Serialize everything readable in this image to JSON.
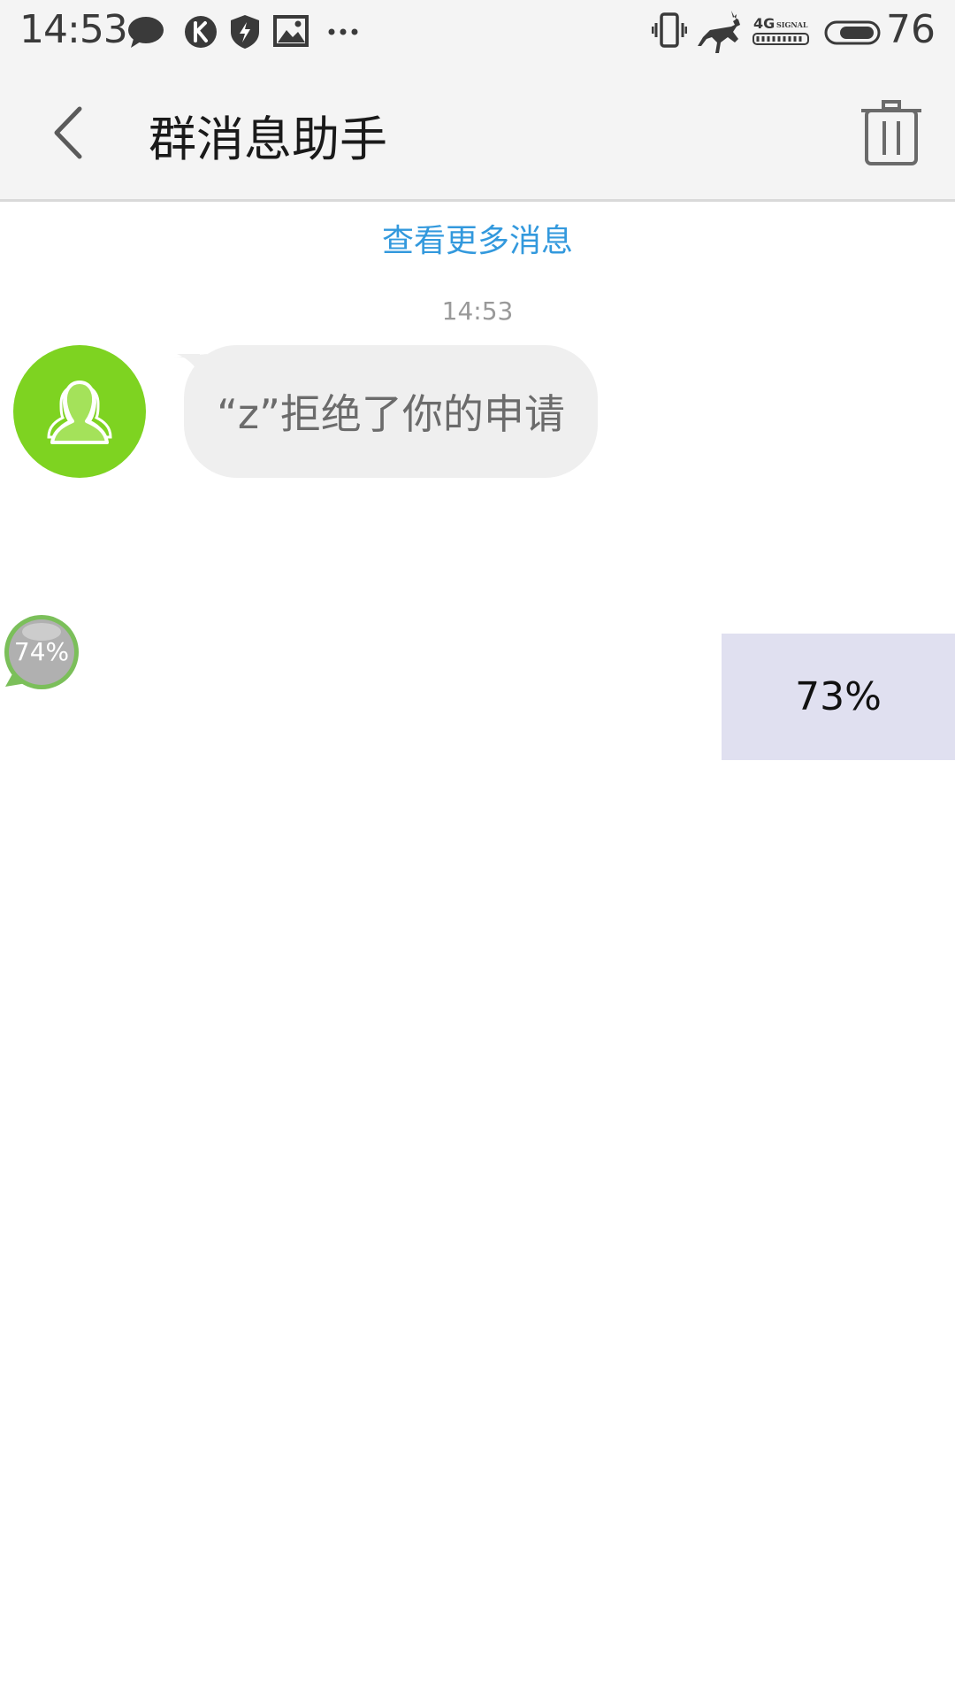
{
  "status_bar": {
    "time": "14:53",
    "left_icons": [
      "chat-bubble-icon",
      "k-app-icon",
      "shield-bolt-icon",
      "image-icon",
      "more-dots-icon"
    ],
    "right_icons": [
      "vibrate-icon",
      "deer-icon",
      "signal-4g-icon",
      "battery-icon"
    ],
    "signal_label": "4G",
    "signal_sub": "SIGNAL",
    "battery_level": "76"
  },
  "header": {
    "title": "群消息助手",
    "back_icon": "chevron-left-icon",
    "trash_icon": "trash-icon"
  },
  "chat": {
    "load_more": "查看更多消息",
    "messages": [
      {
        "time": "14:53",
        "avatar_icon": "group-people-icon",
        "avatar_color": "#7ed321",
        "text": "“z”拒绝了你的申请"
      }
    ]
  },
  "overlays": {
    "float_ball_percent": "74%",
    "memory_panel_percent": "73%"
  },
  "colors": {
    "link": "#3399dd",
    "bar_bg": "#f4f4f4",
    "bubble_bg": "#efefef",
    "panel_bg": "#e0e0f0"
  }
}
